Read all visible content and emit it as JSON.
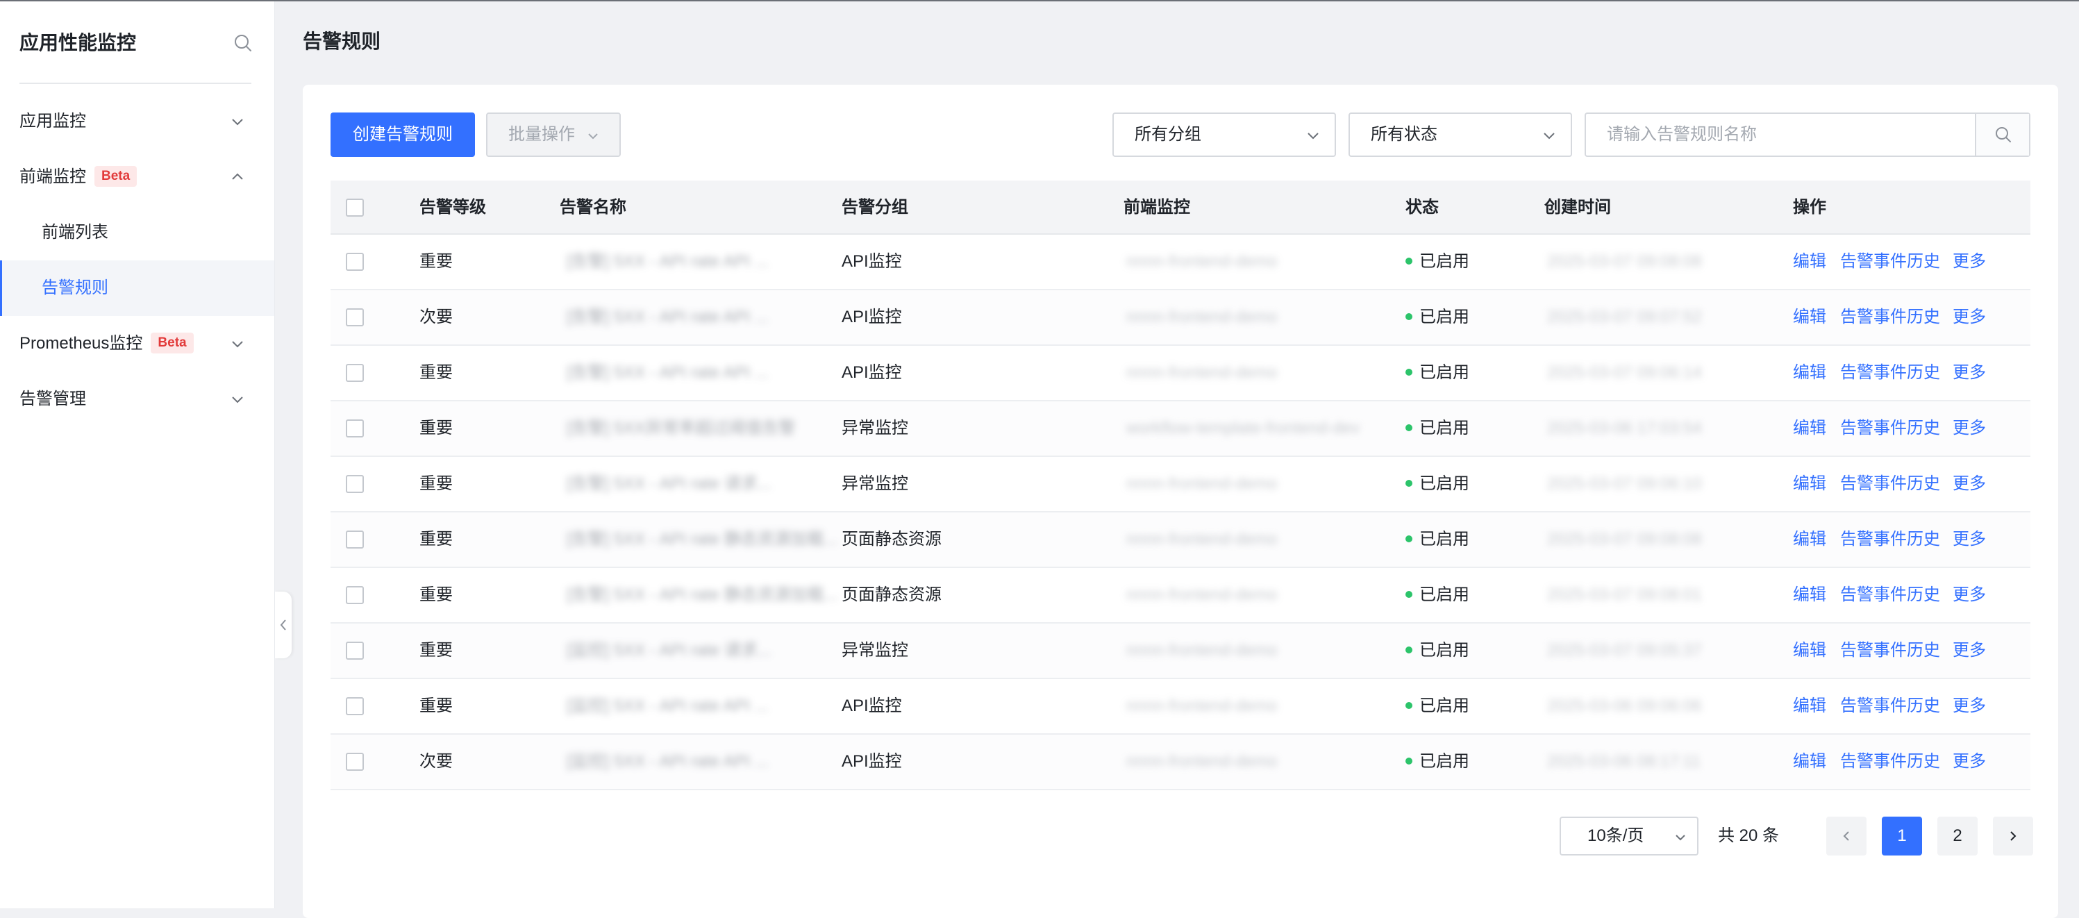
{
  "sidebar": {
    "title": "应用性能监控",
    "items": [
      {
        "label": "应用监控",
        "icon": "chevron-down-icon"
      },
      {
        "label": "前端监控",
        "badge": "Beta",
        "icon": "chevron-up-icon"
      },
      {
        "label": "前端列表"
      },
      {
        "label": "告警规则",
        "active": true
      },
      {
        "label": "Prometheus监控",
        "badge": "Beta",
        "icon": "chevron-down-icon"
      },
      {
        "label": "告警管理",
        "icon": "chevron-down-icon"
      }
    ]
  },
  "page": {
    "title": "告警规则"
  },
  "toolbar": {
    "create_label": "创建告警规则",
    "batch_label": "批量操作",
    "group_filter": "所有分组",
    "status_filter": "所有状态",
    "search_placeholder": "请输入告警规则名称"
  },
  "table": {
    "columns": [
      "告警等级",
      "告警名称",
      "告警分组",
      "前端监控",
      "状态",
      "创建时间",
      "操作"
    ],
    "rows": [
      {
        "level": "重要",
        "name": "[告警] 5XX - API rate API ...",
        "group": "API监控",
        "monitor": "nnnn-frontend-demo",
        "status": "已启用",
        "created": "2025-03-07 09:08:08"
      },
      {
        "level": "次要",
        "name": "[告警] 5XX - API rate API ...",
        "group": "API监控",
        "monitor": "nnnn-frontend-demo",
        "status": "已启用",
        "created": "2025-03-07 09:07:52"
      },
      {
        "level": "重要",
        "name": "[告警] 5XX - API rate API ...",
        "group": "API监控",
        "monitor": "nnnn-frontend-demo",
        "status": "已启用",
        "created": "2025-03-07 09:06:14"
      },
      {
        "level": "重要",
        "name": "[告警] 5XX异常率超过阈值告警",
        "group": "异常监控",
        "monitor": "workflow-template-frontend-dev",
        "status": "已启用",
        "created": "2025-03-06 17:03:54"
      },
      {
        "level": "重要",
        "name": "[告警] 5XX - API rate 请求...",
        "group": "异常监控",
        "monitor": "nnnn-frontend-demo",
        "status": "已启用",
        "created": "2025-03-07 09:06:10"
      },
      {
        "level": "重要",
        "name": "[告警] 5XX - API rate 静态资源加载...",
        "group": "页面静态资源",
        "monitor": "nnnn-frontend-demo",
        "status": "已启用",
        "created": "2025-03-07 09:08:08"
      },
      {
        "level": "重要",
        "name": "[告警] 5XX - API rate 静态资源加载...",
        "group": "页面静态资源",
        "monitor": "nnnn-frontend-demo",
        "status": "已启用",
        "created": "2025-03-07 09:08:01"
      },
      {
        "level": "重要",
        "name": "[监控] 5XX - API rate 请求...",
        "group": "异常监控",
        "monitor": "nnnn-frontend-demo",
        "status": "已启用",
        "created": "2025-03-07 09:05:37"
      },
      {
        "level": "重要",
        "name": "[监控] 5XX - API rate API ...",
        "group": "API监控",
        "monitor": "nnnn-frontend-demo",
        "status": "已启用",
        "created": "2025-03-06 09:06:06"
      },
      {
        "level": "次要",
        "name": "[监控] 5XX - API rate API ...",
        "group": "API监控",
        "monitor": "nnnn-frontend-demo",
        "status": "已启用",
        "created": "2025-03-06 08:17:11"
      }
    ],
    "actions": {
      "edit": "编辑",
      "history": "告警事件历史",
      "more": "更多"
    }
  },
  "pagination": {
    "page_size": "10条/页",
    "total": "共 20 条",
    "pages": [
      "1",
      "2"
    ],
    "current": "1"
  },
  "colors": {
    "accent": "#3370ff",
    "status_on": "#2cc46a",
    "badge": "#e23b3b"
  }
}
